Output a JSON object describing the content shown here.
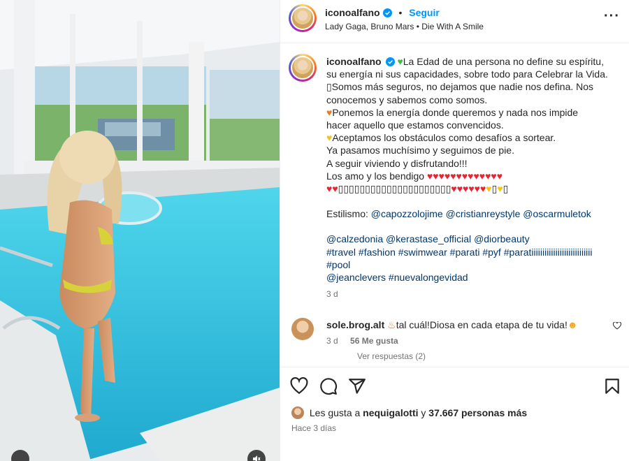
{
  "post": {
    "author": "iconoalfano",
    "follow_label": "Seguir",
    "dot": "•",
    "audio": "Lady Gaga, Bruno Mars • Die With A Smile",
    "more_glyph": "···"
  },
  "caption": {
    "author": "iconoalfano",
    "lines": [
      "La Edad de una persona no define su espíritu,",
      "su energía ni sus capacidades, sobre todo para Celebrar la Vida.",
      "Somos más seguros, no dejamos que nadie nos defina. Nos",
      "conocemos y sabemos como somos.",
      "Ponemos la energía donde queremos y nada nos impide",
      "hacer aquello que estamos convencidos.",
      "Aceptamos los obstáculos como desafíos a sortear.",
      "Ya pasamos muchísimo y seguimos de pie.",
      "A seguir viviendo y disfrutando!!!",
      "Los amo y los bendigo"
    ],
    "styling_label": "Estilismo:",
    "styling_tags": [
      "@capozzolojime",
      "@cristianreystyle",
      "@oscarmuletok"
    ],
    "brand_tags": [
      "@calzedonia",
      "@kerastase_official",
      "@diorbeauty"
    ],
    "hashtags_1": [
      "#travel",
      "#fashion",
      "#swimwear",
      "#parati",
      "#pyf",
      "#paratiiiiiiiiiiiiiiiiiiiiiiiiiiii"
    ],
    "hashtags_2": "#pool",
    "final_tags": [
      "@jeanclevers",
      "#nuevalongevidad"
    ],
    "age": "3 d"
  },
  "comment": {
    "author": "sole.brog.alt",
    "text": "tal cuál!Diosa en cada etapa de tu vida!",
    "age": "3 d",
    "likes": "56 Me gusta",
    "replies": "Ver respuestas (2)"
  },
  "footer": {
    "likes_prefix": "Les gusta a",
    "liked_by": "nequigalotti",
    "likes_joiner": "y",
    "likes_count": "37.667 personas más",
    "when": "Hace 3 días"
  },
  "colors": {
    "accent": "#0095f6",
    "link": "#00376b",
    "muted": "#737373",
    "pool": "#2fc0dc",
    "heart": "#e32634"
  },
  "icons": [
    "verified-badge-icon",
    "more-options-icon",
    "heart-icon",
    "comment-icon",
    "share-icon",
    "bookmark-icon",
    "mute-icon"
  ]
}
